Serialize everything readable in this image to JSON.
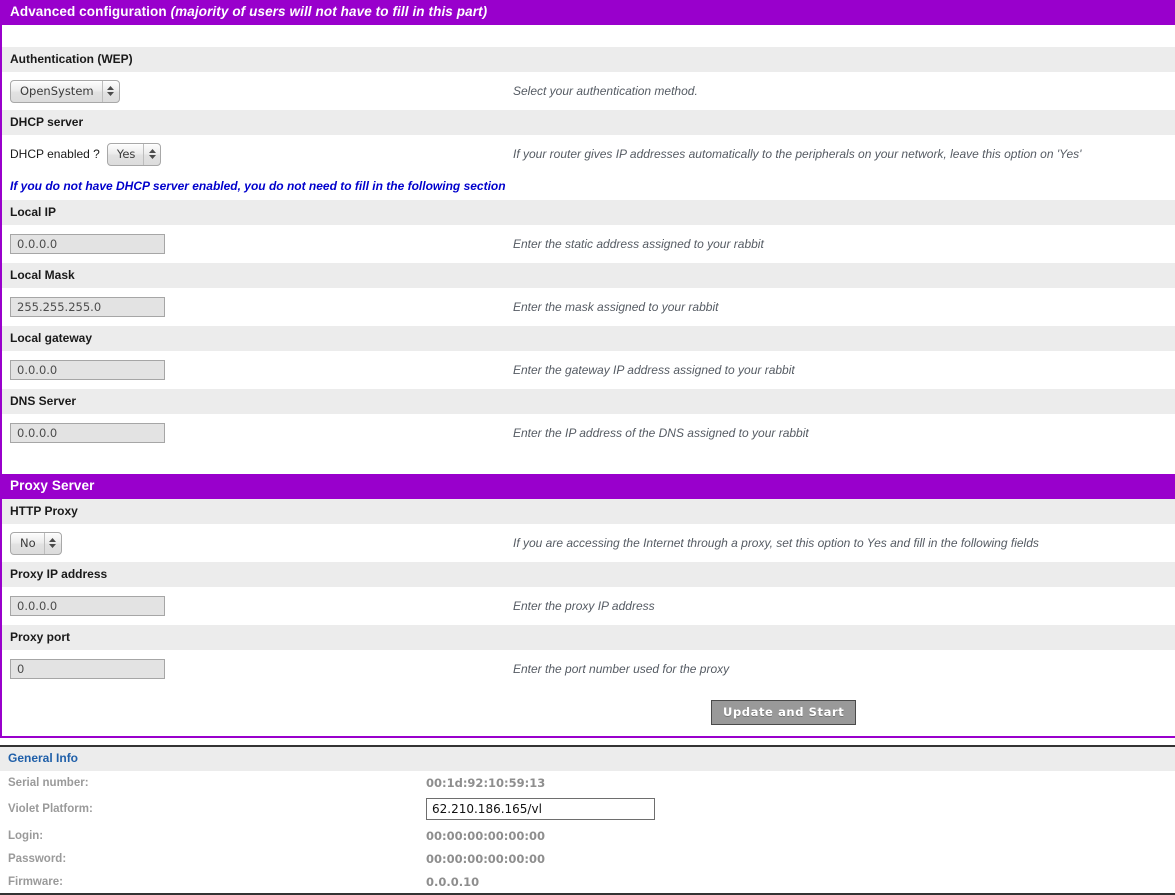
{
  "advanced": {
    "section_title_normal": "Advanced configuration ",
    "section_title_italic": "(majority of users will not have to fill in this part)",
    "auth": {
      "label": "Authentication (WEP)",
      "value": "OpenSystem",
      "hint": "Select your authentication method."
    },
    "dhcp": {
      "label": "DHCP server",
      "inline_label": "DHCP enabled ?",
      "value": "Yes",
      "hint": "If your router gives IP addresses automatically to the peripherals on your network, leave this option on 'Yes'",
      "note": "If you do not have DHCP server enabled, you do not need to fill in the following section"
    },
    "local_ip": {
      "label": "Local IP",
      "value": "0.0.0.0",
      "hint": "Enter the static address assigned to your rabbit"
    },
    "local_mask": {
      "label": "Local Mask",
      "value": "255.255.255.0",
      "hint": "Enter the mask assigned to your rabbit"
    },
    "local_gateway": {
      "label": "Local gateway",
      "value": "0.0.0.0",
      "hint": "Enter the gateway IP address assigned to your rabbit"
    },
    "dns_server": {
      "label": "DNS Server",
      "value": "0.0.0.0",
      "hint": "Enter the IP address of the DNS assigned to your rabbit"
    }
  },
  "proxy": {
    "section_title": "Proxy Server",
    "http_proxy": {
      "label": "HTTP Proxy",
      "value": "No",
      "hint": "If you are accessing the Internet through a proxy, set this option to Yes and fill in the following fields"
    },
    "proxy_ip": {
      "label": "Proxy IP address",
      "value": "0.0.0.0",
      "hint": "Enter the proxy IP address"
    },
    "proxy_port": {
      "label": "Proxy port",
      "value": "0",
      "hint": "Enter the port number used for the proxy"
    }
  },
  "submit": {
    "label": "Update and Start"
  },
  "general_info": {
    "header": "General Info",
    "rows": [
      {
        "key": "Serial number:",
        "value": "00:1d:92:10:59:13"
      },
      {
        "key": "Login:",
        "value": "00:00:00:00:00:00"
      },
      {
        "key": "Password:",
        "value": "00:00:00:00:00:00"
      },
      {
        "key": "Firmware:",
        "value": "0.0.0.10"
      }
    ],
    "violet_platform": {
      "key": "Violet Platform:",
      "value": "62.210.186.165/vl"
    }
  },
  "colors": {
    "accent_purple": "#9900cc",
    "row_label_gray": "#ececec",
    "note_blue": "#0000cc",
    "info_header_blue": "#1f5fa9",
    "button_gray": "#999999"
  }
}
